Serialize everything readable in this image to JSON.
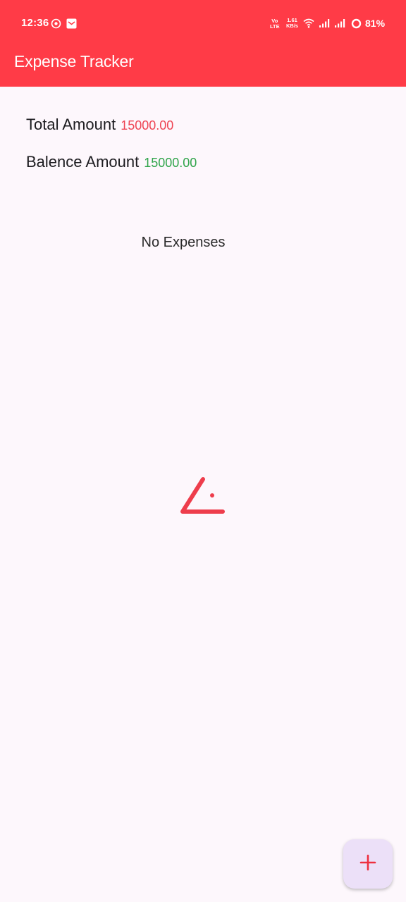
{
  "status_bar": {
    "time": "12:36",
    "volte_top": "Vo",
    "volte_bottom": "LTE",
    "net_speed_value": "1.61",
    "net_speed_unit": "KB/s",
    "battery": "81%"
  },
  "app_bar": {
    "title": "Expense Tracker"
  },
  "summary": {
    "total_label": "Total Amount",
    "total_value": "15000.00",
    "balance_label": "Balence Amount",
    "balance_value": "15000.00"
  },
  "main": {
    "empty_message": "No Expenses"
  },
  "icons": {
    "fab": "plus-icon",
    "loader": "loading-spinner"
  },
  "colors": {
    "primary": "#ff3b47",
    "total_value": "#ee4453",
    "balance_value": "#2fa44a",
    "background": "#fdf7fc",
    "fab_background": "#ece0f8"
  }
}
